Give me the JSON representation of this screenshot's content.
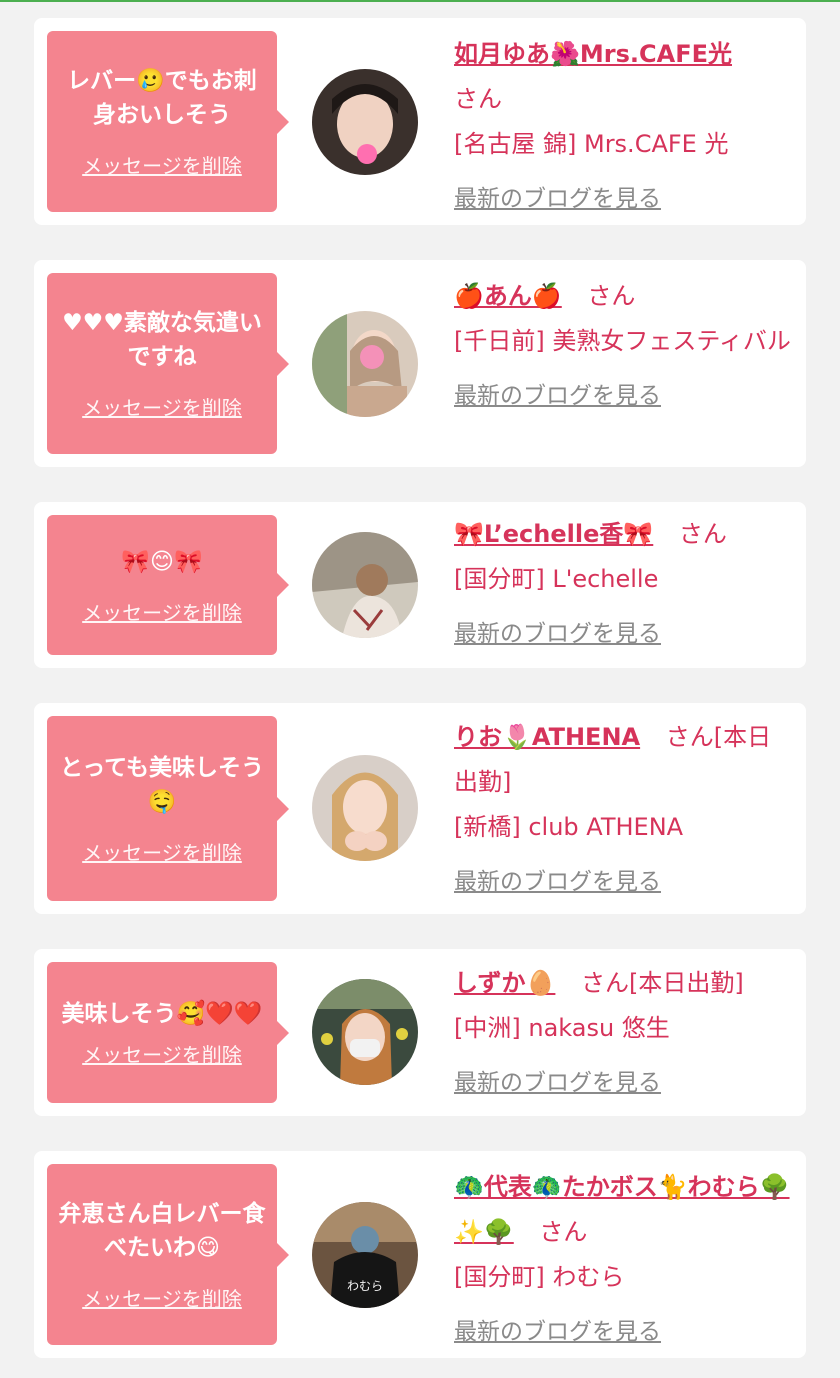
{
  "delete_label": "メッセージを削除",
  "blog_label": "最新のブログを見る",
  "san_label": "さん",
  "accent_color": "#d6335a",
  "bubble_color": "#f4848f",
  "items": [
    {
      "message": "レバー🥲でもお刺身おいしそう",
      "name": "如月ゆあ🌺Mrs.CAFE光",
      "san": "さん",
      "shop": "[名古屋 錦] Mrs.CAFE 光"
    },
    {
      "message": "♥♥♥素敵な気遣いですね",
      "name": "🍎あん🍎",
      "san": "さん",
      "shop": "[千日前] 美熟女フェスティバル"
    },
    {
      "message": "🎀😊🎀",
      "name": "🎀L’echelle香🎀",
      "san": "さん",
      "shop": "[国分町] L'echelle"
    },
    {
      "message": "とっても美味しそう🤤",
      "name": "りお🌷ATHENA",
      "san": "さん[本日出勤]",
      "shop": "[新橋] club ATHENA"
    },
    {
      "message": "美味しそう🥰❤️❤️",
      "name": "しずか🥚",
      "san": "さん[本日出勤]",
      "shop": "[中洲] nakasu 悠生"
    },
    {
      "message": "弁恵さん白レバー食べたいわ😋",
      "name": "🦚代表🦚たかボス🐈わむら🌳✨🌳",
      "san": "さん",
      "shop": "[国分町] わむら"
    }
  ]
}
